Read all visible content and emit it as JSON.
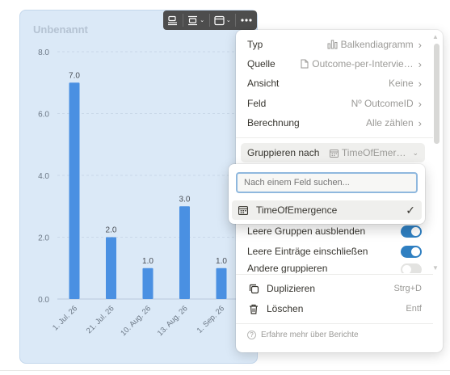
{
  "chart": {
    "title": "Unbenannt"
  },
  "chart_data": {
    "type": "bar",
    "title": "Unbenannt",
    "categories": [
      "1. Jul. 26",
      "21. Jul. 26",
      "10. Aug. 26",
      "13. Aug. 26",
      "1. Sep. 26"
    ],
    "values": [
      7.0,
      2.0,
      1.0,
      3.0,
      1.0
    ],
    "value_labels": [
      "7.0",
      "2.0",
      "1.0",
      "3.0",
      "1.0"
    ],
    "yticks": [
      "0.0",
      "2.0",
      "4.0",
      "6.0",
      "8.0"
    ],
    "ylim": [
      0,
      8
    ],
    "xlabel": "",
    "ylabel": "",
    "grid": true,
    "bar_color": "#4a90e2"
  },
  "toolbar": {
    "buttons": [
      "align-icon",
      "group-icon",
      "chart-style-icon",
      "more-icon"
    ]
  },
  "menu": {
    "rows": [
      {
        "label": "Typ",
        "value": "Balkendiagramm",
        "icon": "bar-chart-icon"
      },
      {
        "label": "Quelle",
        "value": "Outcome-per-Intervie…",
        "icon": "page-icon"
      },
      {
        "label": "Ansicht",
        "value": "Keine",
        "icon": ""
      },
      {
        "label": "Feld",
        "value": "Nº OutcomeID",
        "icon": ""
      },
      {
        "label": "Berechnung",
        "value": "Alle zählen",
        "icon": ""
      }
    ],
    "group_by": {
      "label": "Gruppieren nach",
      "value": "TimeOfEmer…",
      "icon": "calendar-icon"
    },
    "toggles": [
      {
        "label": "Leere Gruppen ausblenden",
        "on": true
      },
      {
        "label": "Leere Einträge einschließen",
        "on": true
      },
      {
        "label": "Andere gruppieren",
        "on": false
      }
    ],
    "actions": [
      {
        "label": "Duplizieren",
        "shortcut": "Strg+D",
        "icon": "duplicate-icon"
      },
      {
        "label": "Löschen",
        "shortcut": "Entf",
        "icon": "trash-icon"
      }
    ],
    "footer": "Erfahre mehr über Berichte"
  },
  "popover": {
    "search_placeholder": "Nach einem Feld suchen...",
    "option": "TimeOfEmergence",
    "option_selected": true
  }
}
